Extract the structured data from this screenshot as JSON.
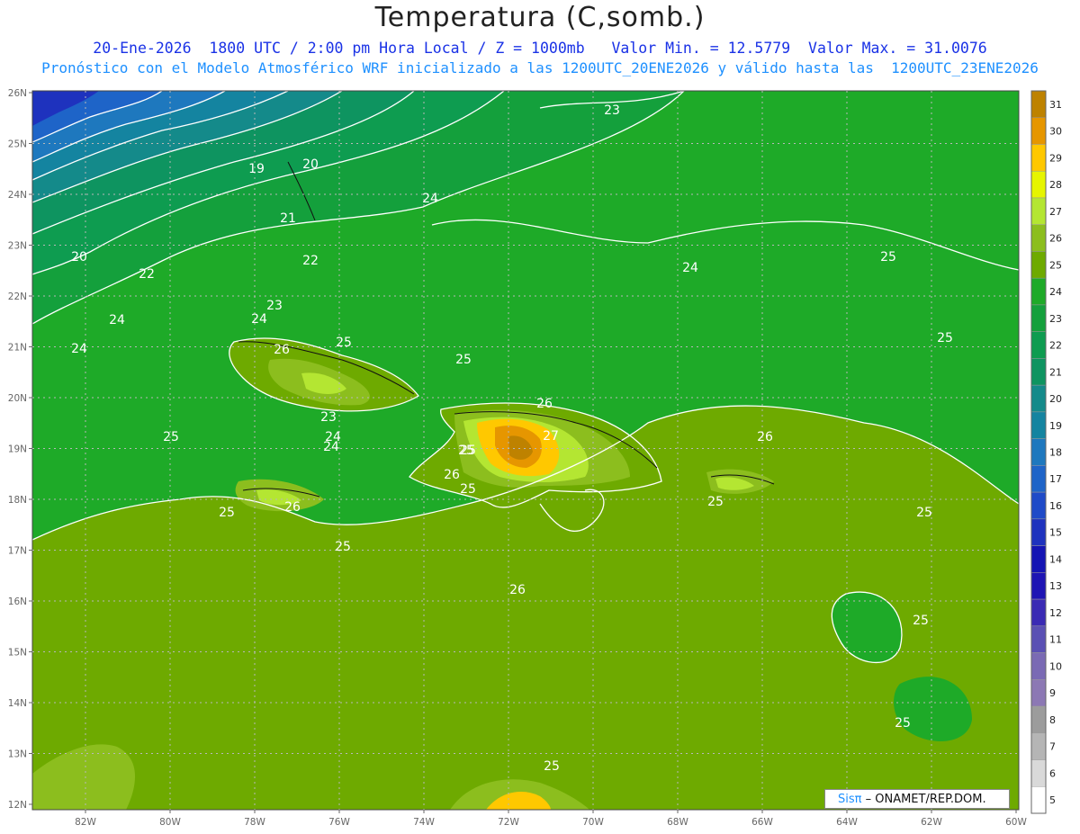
{
  "header": {
    "title": "Temperatura (C,somb.)",
    "line1": "20-Ene-2026  1800 UTC / 2:00 pm Hora Local / Z = 1000mb   Valor Min. = 12.5779  Valor Max. = 31.0076",
    "line2": "Pronóstico con el Modelo Atmosférico WRF inicializado a las 1200UTC_20ENE2026 y válido hasta las  1200UTC_23ENE2026"
  },
  "credit": {
    "brand": "Sisπ",
    "text": " – ONAMET/REP.DOM."
  },
  "axes": {
    "lat_labels": [
      "26N",
      "25N",
      "24N",
      "23N",
      "22N",
      "21N",
      "20N",
      "19N",
      "18N",
      "17N",
      "16N",
      "15N",
      "14N",
      "13N",
      "12N"
    ],
    "lon_labels": [
      "82W",
      "80W",
      "78W",
      "76W",
      "74W",
      "72W",
      "70W",
      "68W",
      "66W",
      "64W",
      "62W",
      "60W"
    ]
  },
  "colorbar": {
    "levels": [
      "5",
      "6",
      "7",
      "8",
      "9",
      "10",
      "11",
      "12",
      "13",
      "14",
      "15",
      "16",
      "17",
      "18",
      "19",
      "20",
      "21",
      "22",
      "23",
      "24",
      "25",
      "26",
      "27",
      "28",
      "29",
      "30",
      "31"
    ],
    "colors": [
      "#ffffff",
      "#d9d9d9",
      "#b5b5b5",
      "#9c9c9c",
      "#8c78b4",
      "#7a6ab4",
      "#5a50b4",
      "#3a2ab4",
      "#1e14b4",
      "#1414b4",
      "#1e32be",
      "#1e4ac8",
      "#1e64c8",
      "#1e78be",
      "#1484a0",
      "#148a8a",
      "#0e9460",
      "#0e9c50",
      "#14a03c",
      "#1eaa28",
      "#6eaa00",
      "#8cbe1e",
      "#b4e632",
      "#e6f500",
      "#ffc800",
      "#e69600",
      "#be8200"
    ]
  },
  "contour_labels": [
    "23",
    "19",
    "20",
    "24",
    "21",
    "20",
    "22",
    "22",
    "24",
    "23",
    "24",
    "26",
    "25",
    "23",
    "25",
    "26",
    "25",
    "24",
    "24",
    "25",
    "25",
    "26",
    "27",
    "25",
    "26",
    "25",
    "25",
    "26",
    "25",
    "26",
    "25",
    "25",
    "25",
    "25",
    "24",
    "25",
    "24",
    "25"
  ]
}
